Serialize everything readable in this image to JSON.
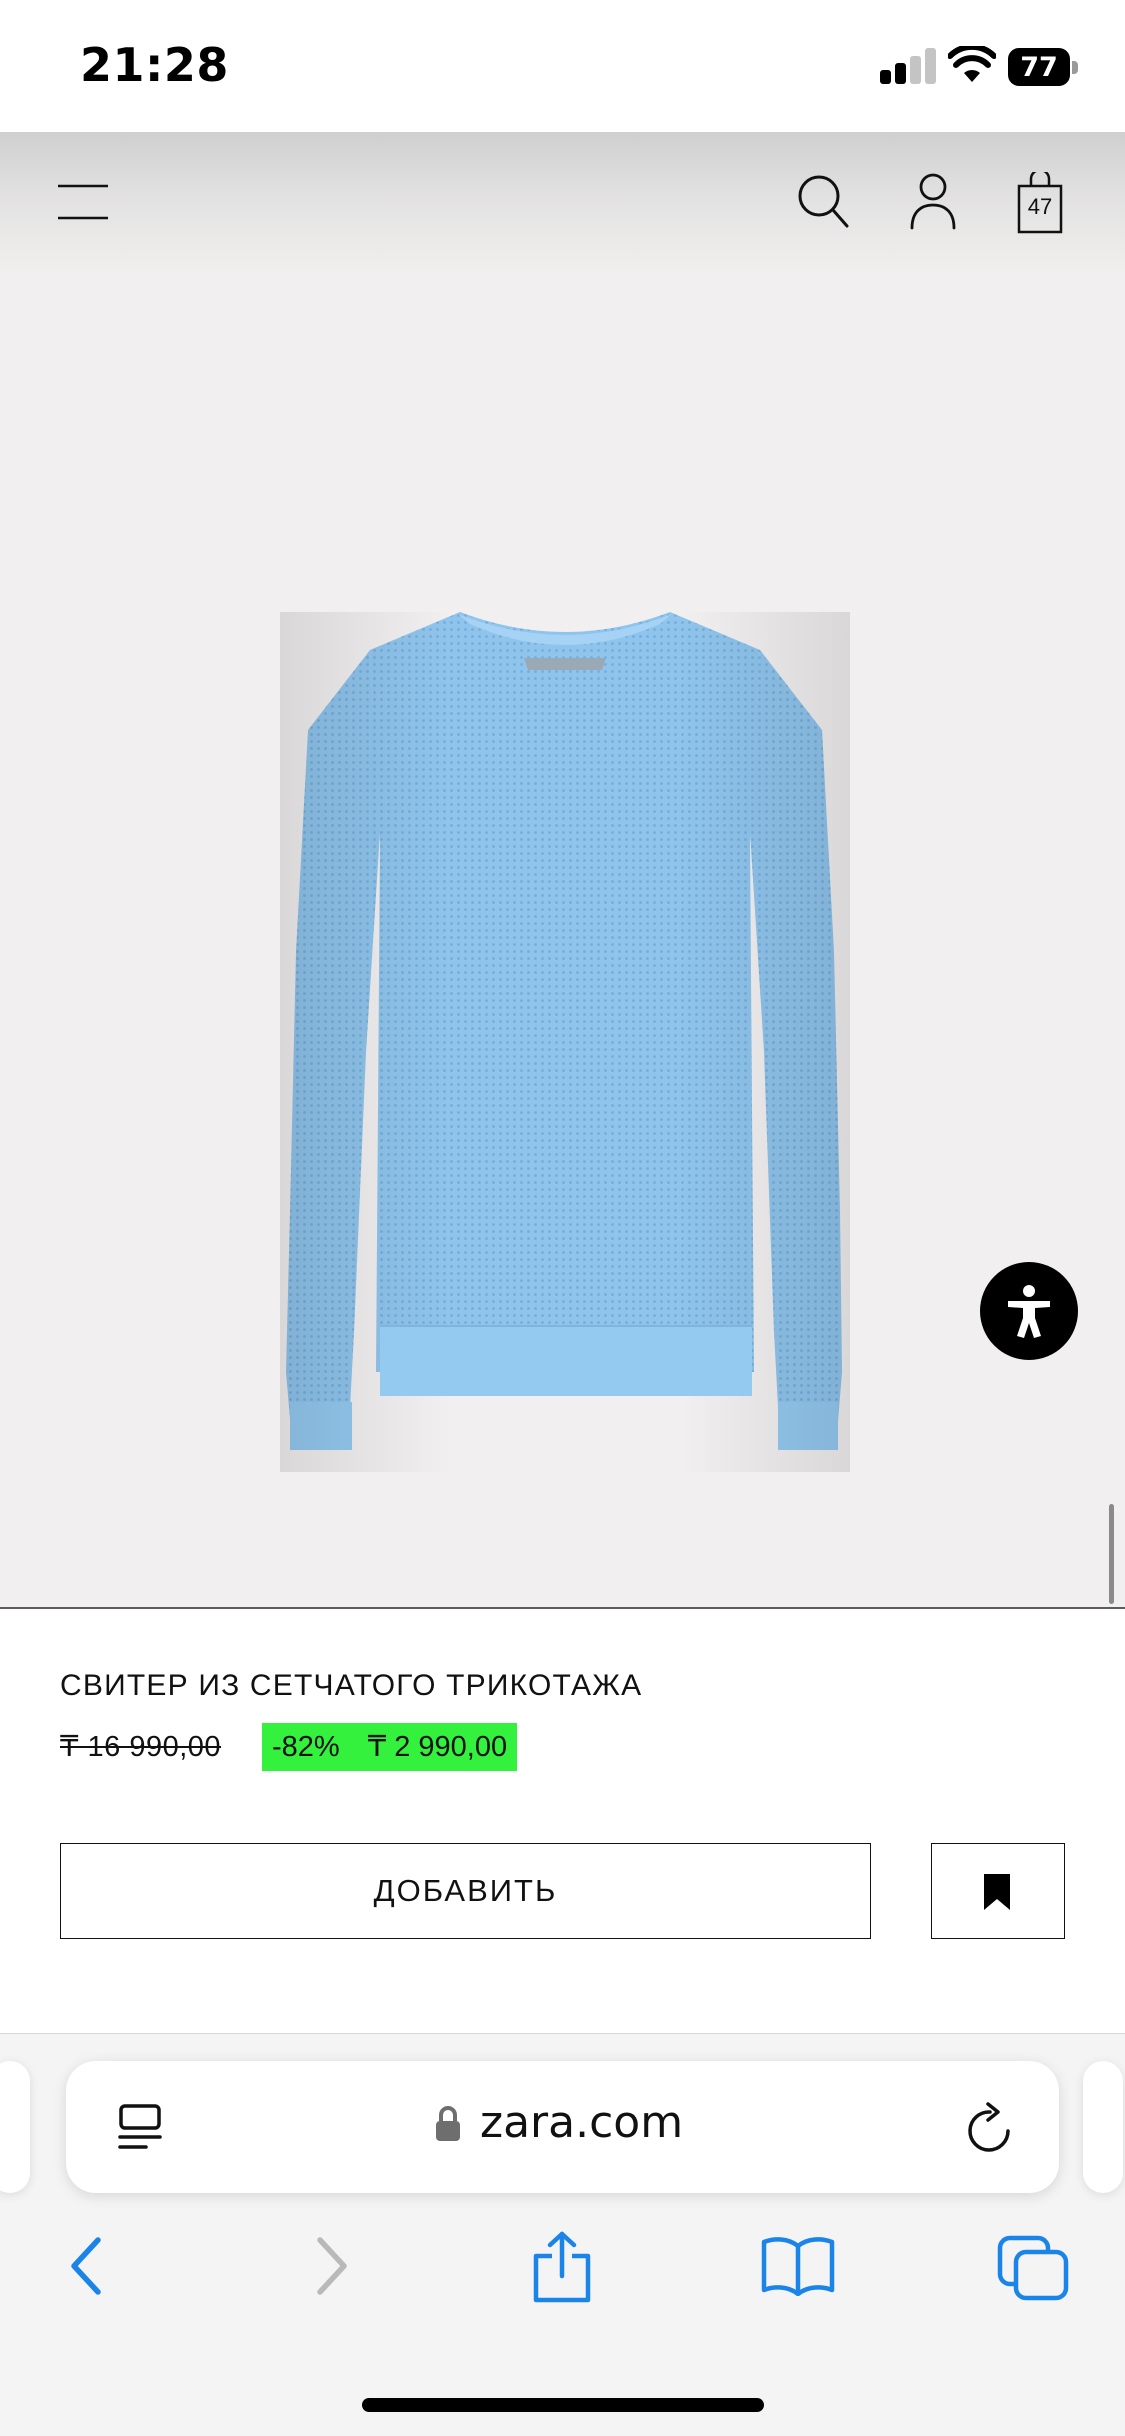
{
  "status_bar": {
    "time": "21:28",
    "battery_level": "77",
    "signal_strength": "2 of 4 bars",
    "icons": [
      "signal-icon",
      "wifi-icon",
      "battery-icon"
    ]
  },
  "header": {
    "icons": [
      "menu-icon",
      "search-icon",
      "account-icon",
      "shopping-bag-icon"
    ],
    "bag_count": "47"
  },
  "product": {
    "image": "light blue mesh knit sweater",
    "sweater_color": "#8fc4ec",
    "name": "СВИТЕР ИЗ СЕТЧАТОГО ТРИКОТАЖА",
    "old_price": "₸ 16 990,00",
    "discount": "-82%",
    "sale_price": "₸ 2 990,00",
    "sale_badge_color": "#33f13d",
    "add_button_label": "ДОБАВИТЬ",
    "bookmark_icon": "bookmark-icon"
  },
  "accessibility": {
    "icon": "accessibility-icon"
  },
  "browser": {
    "url": "zara.com",
    "icons": [
      "reader-mode-icon",
      "lock-icon",
      "reload-icon"
    ],
    "toolbar": [
      "back-icon",
      "forward-icon",
      "share-icon",
      "bookmarks-icon",
      "tabs-icon"
    ],
    "accent_color": "#1a84e8"
  }
}
